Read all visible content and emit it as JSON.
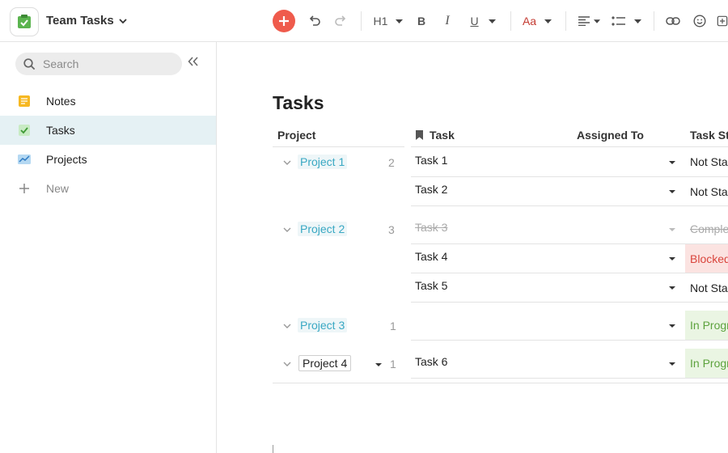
{
  "app": {
    "title": "Team Tasks"
  },
  "colors": {
    "accent": "#ef5b4c",
    "link": "#39a8c3",
    "active_bg": "#e5f1f4",
    "blocked": "#d9453c",
    "in_progress": "#5ca23d"
  },
  "toolbar": {
    "add_icon": "plus-circle-icon",
    "heading_label": "H1",
    "bold_label": "B",
    "italic_label": "I",
    "underline_label": "U",
    "text_color_label": "Aa"
  },
  "sidebar": {
    "search_placeholder": "Search",
    "items": [
      {
        "label": "Notes",
        "icon": "notes-icon",
        "active": false
      },
      {
        "label": "Tasks",
        "icon": "checkbox-icon",
        "active": true
      },
      {
        "label": "Projects",
        "icon": "chart-icon",
        "active": false
      },
      {
        "label": "New",
        "icon": "plus-icon",
        "active": false
      }
    ]
  },
  "page": {
    "title": "Tasks",
    "columns": {
      "project": "Project",
      "task": "Task",
      "assigned": "Assigned To",
      "status": "Task Status"
    },
    "groups": [
      {
        "project": "Project 1",
        "count": "2",
        "rows": [
          {
            "task": "Task 1",
            "status": "Not Started",
            "state": "ns"
          },
          {
            "task": "Task 2",
            "status": "Not Started",
            "state": "ns"
          }
        ]
      },
      {
        "project": "Project 2",
        "count": "3",
        "rows": [
          {
            "task": "Task 3",
            "status": "Complete",
            "state": "done"
          },
          {
            "task": "Task 4",
            "status": "Blocked",
            "state": "blocked"
          },
          {
            "task": "Task 5",
            "status": "Not Started",
            "state": "ns"
          }
        ]
      },
      {
        "project": "Project 3",
        "count": "1",
        "rows": [
          {
            "task": "",
            "status": "In Progress",
            "state": "prog"
          }
        ]
      },
      {
        "project": "Project 4",
        "count": "1",
        "rows": [
          {
            "task": "Task 6",
            "status": "In Progress",
            "state": "prog"
          }
        ]
      }
    ]
  }
}
